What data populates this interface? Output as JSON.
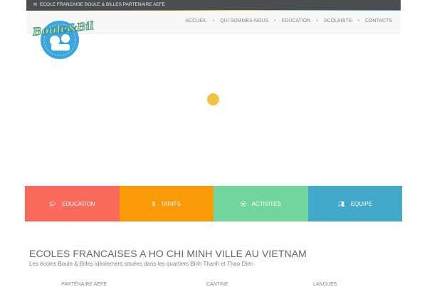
{
  "topbar": {
    "text": "ECOLE FRANCAISE BOULE & BILLES PARTENAIRE AEFE"
  },
  "logo": {
    "text": "Boule & Billes"
  },
  "menu": [
    "ACCUEIL",
    "QUI SOMMES-NOUS",
    "EDUCATION",
    "SCOLARITE",
    "CONTACTS"
  ],
  "tiles": [
    {
      "label": "EDUCATION",
      "icon": "graduation-cap-icon",
      "color": "#fc6a5c"
    },
    {
      "label": "TARIFS",
      "icon": "dollar-icon",
      "color": "#fa9a06"
    },
    {
      "label": "ACTIVITES",
      "icon": "soccer-ball-icon",
      "color": "#72d69c"
    },
    {
      "label": "EQUIPE",
      "icon": "users-icon",
      "color": "#43a9c8"
    }
  ],
  "heading": "ECOLES FRANCAISES A HO CHI MINH VILLE AU VIETNAM",
  "subheading": "Les écoles Boule & Billes idéalement situées dans les quartiers Binh Thanh et Thao Dien",
  "columns": [
    "PARTENAIRE AEFE",
    "CANTINE",
    "LANGUES"
  ]
}
